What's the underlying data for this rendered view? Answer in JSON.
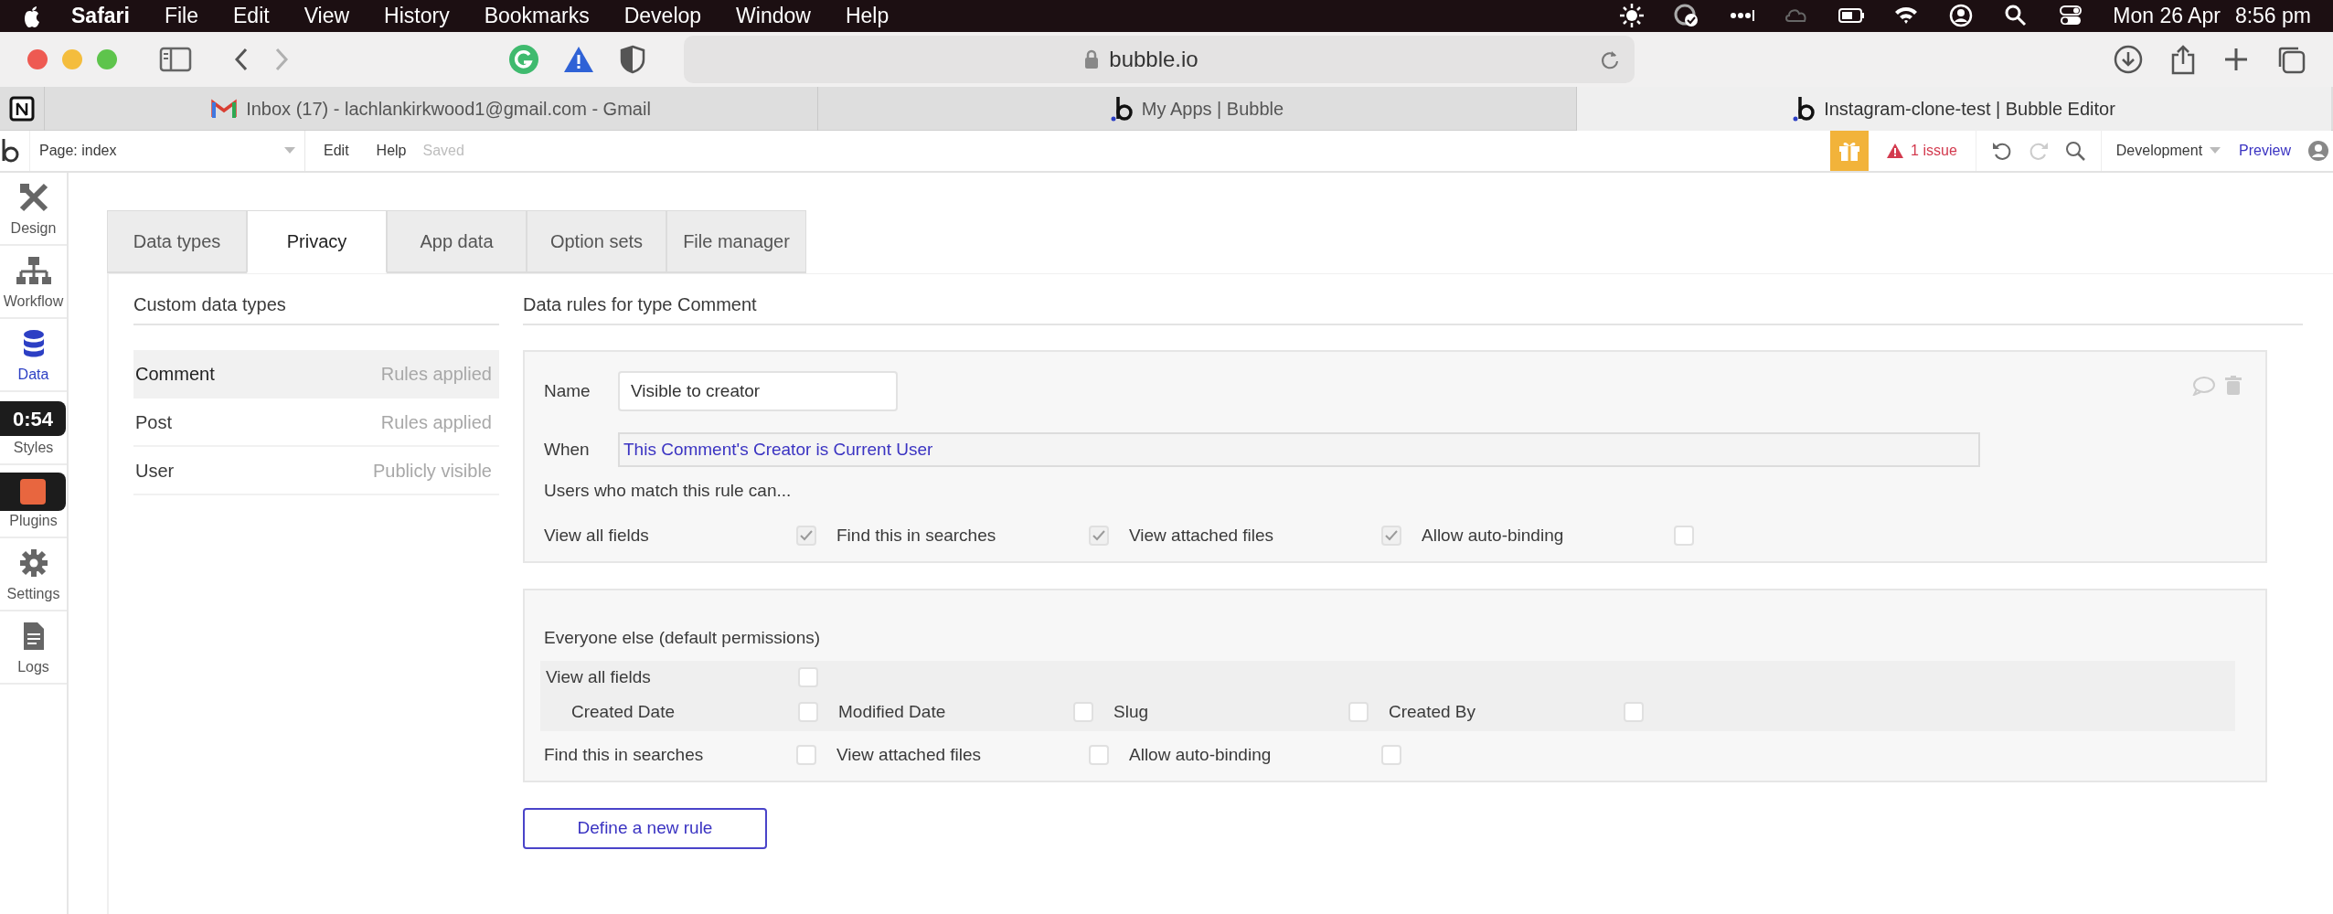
{
  "menubar": {
    "app": "Safari",
    "menus": [
      "File",
      "Edit",
      "View",
      "History",
      "Bookmarks",
      "Develop",
      "Window",
      "Help"
    ],
    "date": "Mon 26 Apr",
    "time": "8:56 pm"
  },
  "browser": {
    "url": "bubble.io",
    "tabs": [
      {
        "title": "Inbox (17) - lachlankirkwood1@gmail.com - Gmail",
        "kind": "mail",
        "selected": false
      },
      {
        "title": "My Apps | Bubble",
        "kind": "bubble",
        "selected": false
      },
      {
        "title": "Instagram-clone-test | Bubble Editor",
        "kind": "bubble",
        "selected": true
      }
    ]
  },
  "editor_header": {
    "page": "Page: index",
    "menus": [
      "Edit",
      "Help"
    ],
    "save_status": "Saved",
    "issues": "1 issue",
    "mode": "Development",
    "preview": "Preview"
  },
  "sidebar": [
    {
      "label": "Design",
      "selected": false
    },
    {
      "label": "Workflow",
      "selected": false
    },
    {
      "label": "Data",
      "selected": true
    },
    {
      "label": "Styles",
      "selected": false
    },
    {
      "label": "Plugins",
      "selected": false
    },
    {
      "label": "Settings",
      "selected": false
    },
    {
      "label": "Logs",
      "selected": false
    }
  ],
  "recorder": {
    "time": "0:54"
  },
  "tabs": [
    {
      "label": "Data types",
      "selected": false
    },
    {
      "label": "Privacy",
      "selected": true
    },
    {
      "label": "App data",
      "selected": false
    },
    {
      "label": "Option sets",
      "selected": false
    },
    {
      "label": "File manager",
      "selected": false
    }
  ],
  "types_panel": {
    "title": "Custom data types",
    "items": [
      {
        "name": "Comment",
        "status": "Rules applied",
        "selected": true
      },
      {
        "name": "Post",
        "status": "Rules applied",
        "selected": false
      },
      {
        "name": "User",
        "status": "Publicly visible",
        "selected": false
      }
    ]
  },
  "rules_panel": {
    "title": "Data rules for type Comment",
    "rule": {
      "name_label": "Name",
      "name": "Visible to creator",
      "when_label": "When",
      "when": "This Comment's Creator is Current User",
      "permissions_label": "Users who match this rule can...",
      "permissions": [
        {
          "label": "View all fields",
          "checked": true
        },
        {
          "label": "Find this in searches",
          "checked": true
        },
        {
          "label": "View attached files",
          "checked": true
        },
        {
          "label": "Allow auto-binding",
          "checked": false
        }
      ]
    },
    "default": {
      "title": "Everyone else (default permissions)",
      "view_all": {
        "label": "View all fields",
        "checked": false
      },
      "fields": [
        {
          "label": "Created Date",
          "checked": false
        },
        {
          "label": "Modified Date",
          "checked": false
        },
        {
          "label": "Slug",
          "checked": false
        },
        {
          "label": "Created By",
          "checked": false
        }
      ],
      "permissions": [
        {
          "label": "Find this in searches",
          "checked": false
        },
        {
          "label": "View attached files",
          "checked": false
        },
        {
          "label": "Allow auto-binding",
          "checked": false
        }
      ]
    },
    "new_rule_button": "Define a new rule"
  }
}
